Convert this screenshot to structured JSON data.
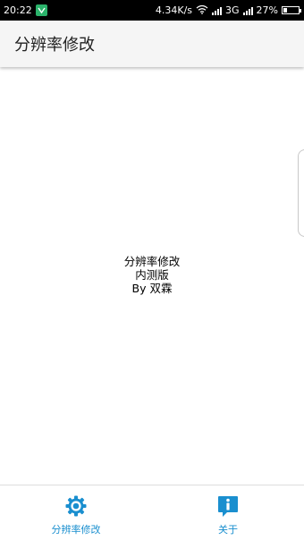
{
  "status_bar": {
    "time": "20:22",
    "speed": "4.34K/s",
    "network": "3G",
    "battery_percent": "27%",
    "battery_level": 0.27,
    "notification_icon": "app-notification-icon"
  },
  "app_bar": {
    "title": "分辨率修改"
  },
  "main": {
    "line1": "分辨率修改",
    "line2": "内测版",
    "line3": "By 双霖"
  },
  "bottom_nav": {
    "items": [
      {
        "label": "分辨率修改",
        "icon": "gear-icon",
        "active": true
      },
      {
        "label": "关于",
        "icon": "info-icon",
        "active": false
      }
    ],
    "accent": "#1a8fcf"
  }
}
